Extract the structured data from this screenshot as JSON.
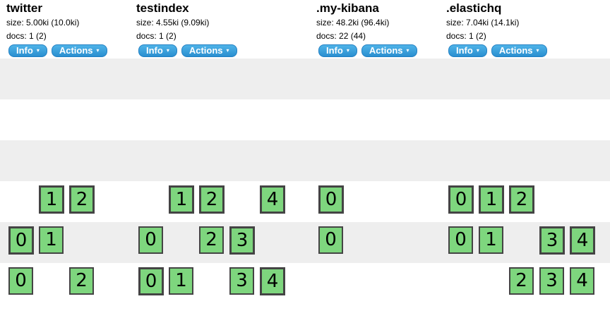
{
  "indices": [
    {
      "name": "twitter",
      "size": "size: 5.00ki (10.0ki)",
      "docs": "docs: 1 (2)"
    },
    {
      "name": "testindex",
      "size": "size: 4.55ki (9.09ki)",
      "docs": "docs: 1 (2)"
    },
    {
      "name": ".my-kibana",
      "size": "size: 48.2ki (96.4ki)",
      "docs": "docs: 22 (44)"
    },
    {
      "name": ".elastichq",
      "size": "size: 7.04ki (14.1ki)",
      "docs": "docs: 1 (2)"
    }
  ],
  "buttons": {
    "info": "Info",
    "actions": "Actions",
    "caret": "▾"
  },
  "shards": {
    "row1": {
      "twitter": [
        "1",
        "2"
      ],
      "testindex": [
        "1",
        "2",
        "4"
      ],
      "mykibana": [
        "0"
      ],
      "elastichq": [
        "0",
        "1",
        "2"
      ]
    },
    "row2": {
      "twitter": [
        "0",
        "1"
      ],
      "testindex": [
        "0",
        "2",
        "3"
      ],
      "mykibana": [
        "0"
      ],
      "elastichq": [
        "0",
        "1",
        "3",
        "4"
      ]
    },
    "row3": {
      "twitter": [
        "0",
        "2"
      ],
      "testindex": [
        "0",
        "1",
        "3",
        "4"
      ],
      "elastichq": [
        "2",
        "3",
        "4"
      ]
    }
  }
}
